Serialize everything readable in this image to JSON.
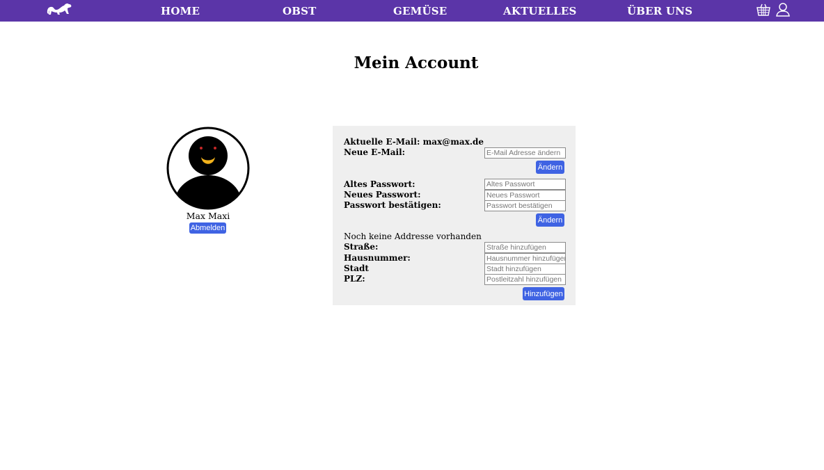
{
  "nav": {
    "logo_icon": "ferret-logo-icon",
    "items": [
      "HOME",
      "OBST",
      "GEMÜSE",
      "AKTUELLES",
      "ÜBER UNS"
    ],
    "cart_icon": "basket-icon",
    "user_icon": "user-icon",
    "bg_color": "#5b35a8"
  },
  "page": {
    "title": "Mein Account"
  },
  "profile": {
    "name": "Max Maxi",
    "logout_label": "Abmelden"
  },
  "email": {
    "current_label": "Aktuelle E-Mail:",
    "current_value": "max@max.de",
    "new_label": "Neue E-Mail:",
    "new_placeholder": "E-Mail Adresse ändern",
    "submit_label": "Ändern"
  },
  "password": {
    "old_label": "Altes Passwort:",
    "old_placeholder": "Altes Passwort",
    "new_label": "Neues Passwort:",
    "new_placeholder": "Neues Passwort",
    "confirm_label": "Passwort bestätigen:",
    "confirm_placeholder": "Passwort bestätigen",
    "submit_label": "Ändern"
  },
  "address": {
    "status": "Noch keine Addresse vorhanden",
    "street_label": "Straße:",
    "street_placeholder": "Straße hinzufügen",
    "house_label": "Hausnummer:",
    "house_placeholder": "Hausnummer hinzufügen",
    "city_label": "Stadt",
    "city_placeholder": "Stadt hinzufügen",
    "zip_label": "PLZ:",
    "zip_placeholder": "Postleitzahl hinzufügen",
    "submit_label": "Hinzufügen"
  },
  "colors": {
    "button": "#3f63e3",
    "panel": "#efefef"
  }
}
